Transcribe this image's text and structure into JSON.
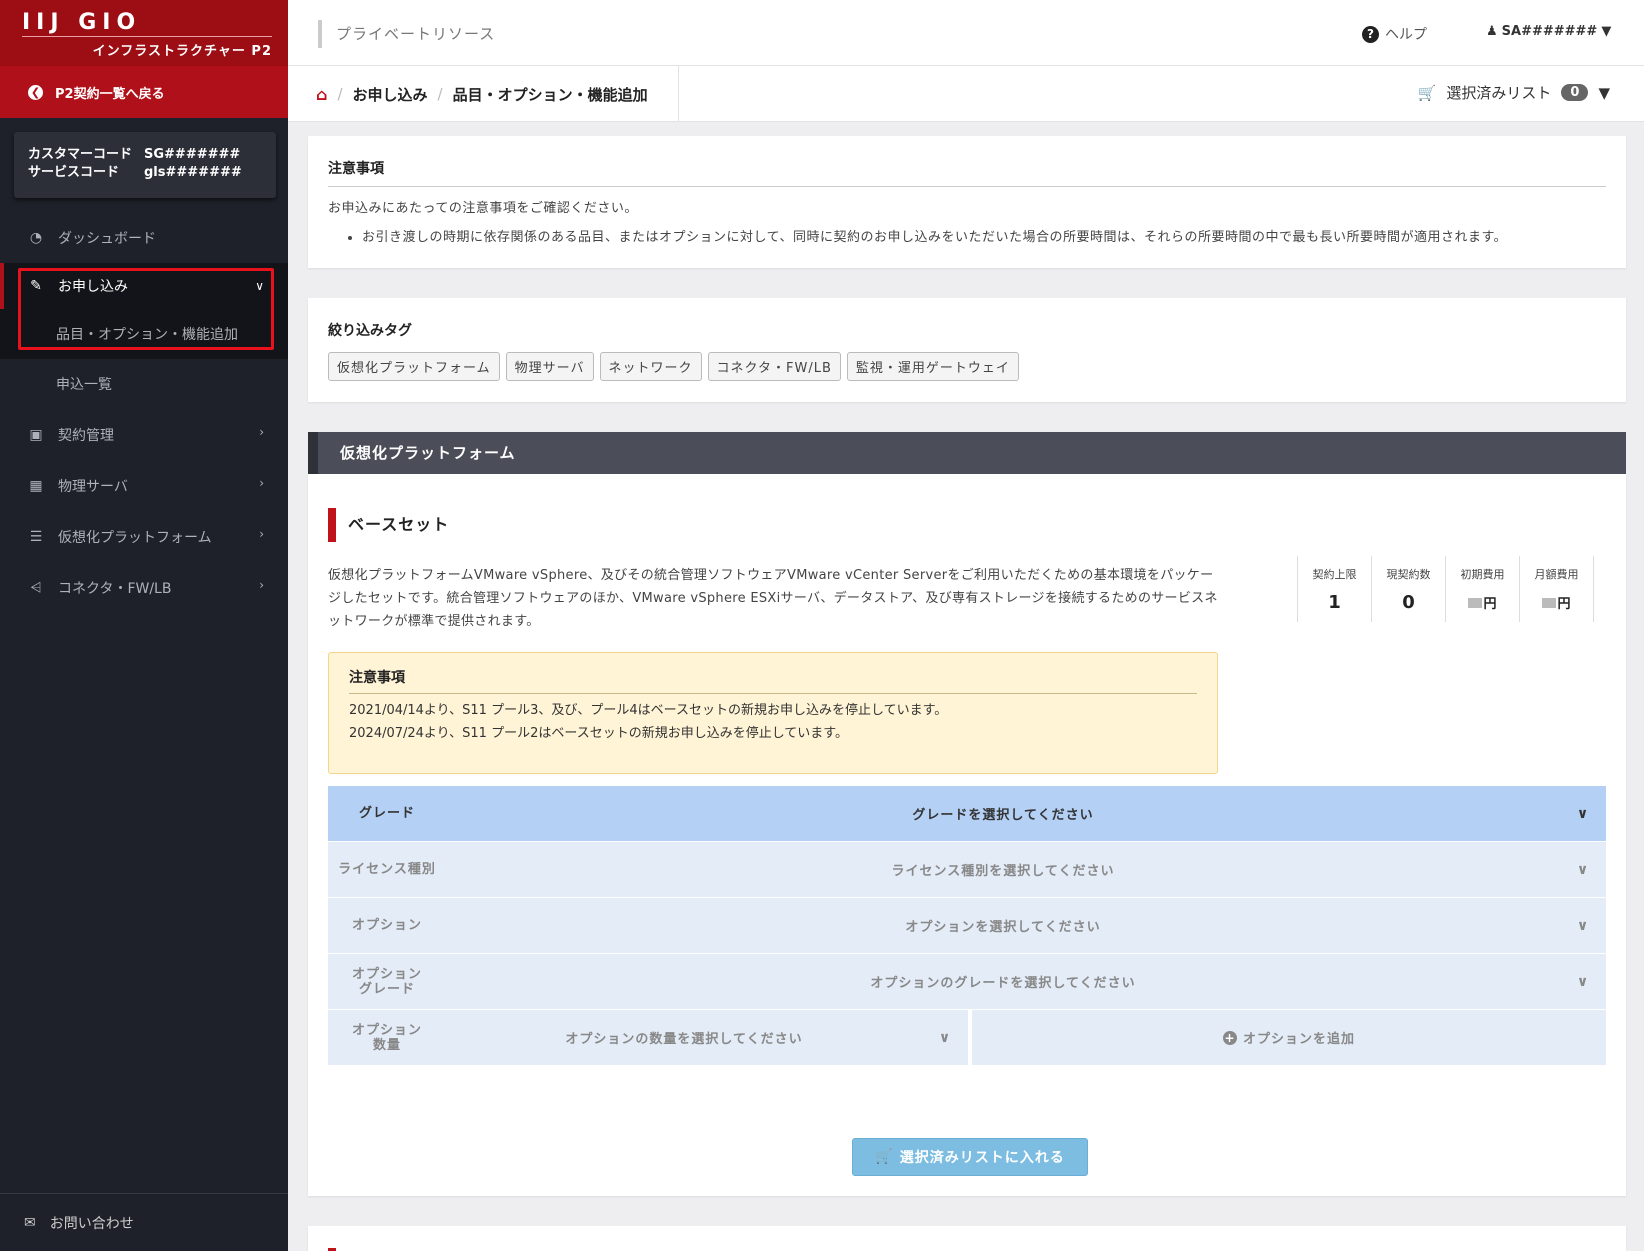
{
  "brand": {
    "logo": "IIJ GIO",
    "subtitle": "インフラストラクチャー P2",
    "back_label": "P2契約一覧へ戻る"
  },
  "codes": [
    {
      "key": "カスタマーコード",
      "value": "SG#######"
    },
    {
      "key": "サービスコード",
      "value": "gls#######"
    }
  ],
  "nav": {
    "dashboard": "ダッシュボード",
    "apply": "お申し込み",
    "apply_sub1": "品目・オプション・機能追加",
    "apply_sub2": "申込一覧",
    "contract": "契約管理",
    "physical": "物理サーバ",
    "virtual": "仮想化プラットフォーム",
    "connector": "コネクタ・FW/LB"
  },
  "contact": "お問い合わせ",
  "header": {
    "title": "プライベートリソース",
    "help": "ヘルプ",
    "user": "SA#######"
  },
  "breadcrumb": {
    "item1": "お申し込み",
    "item2": "品目・オプション・機能追加"
  },
  "cart": {
    "label": "選択済みリスト",
    "count": "0"
  },
  "notice": {
    "title": "注意事項",
    "intro": "お申込みにあたっての注意事項をご確認ください。",
    "item": "お引き渡しの時期に依存関係のある品目、またはオプションに対して、同時に契約のお申し込みをいただいた場合の所要時間は、それらの所要時間の中で最も長い所要時間が適用されます。"
  },
  "filter": {
    "title": "絞り込みタグ",
    "tags": [
      "仮想化プラットフォーム",
      "物理サーバ",
      "ネットワーク",
      "コネクタ・FW/LB",
      "監視・運用ゲートウェイ"
    ]
  },
  "section_title": "仮想化プラットフォーム",
  "baseset": {
    "title": "ベースセット",
    "desc": "仮想化プラットフォームVMware vSphere、及びその統合管理ソフトウェアVMware vCenter Serverをご利用いただくための基本環境をパッケージしたセットです。統合管理ソフトウェアのほか、VMware vSphere ESXiサーバ、データストア、及び専有ストレージを接続するためのサービスネットワークが標準で提供されます。",
    "stats": [
      {
        "label": "契約上限",
        "value": "1"
      },
      {
        "label": "現契約数",
        "value": "0"
      },
      {
        "label": "初期費用",
        "value": "円"
      },
      {
        "label": "月額費用",
        "value": "円"
      }
    ],
    "warning": {
      "title": "注意事項",
      "line1": "2021/04/14より、S11 プール3、及び、プール4はベースセットの新規お申し込みを停止しています。",
      "line2": "2024/07/24より、S11 プール2はベースセットの新規お申し込みを停止しています。"
    },
    "selectors": {
      "grade_label": "グレード",
      "grade_value": "グレードを選択してください",
      "license_label": "ライセンス種別",
      "license_value": "ライセンス種別を選択してください",
      "option_label": "オプション",
      "option_value": "オプションを選択してください",
      "option_grade_label1": "オプション",
      "option_grade_label2": "グレード",
      "option_grade_value": "オプションのグレードを選択してください",
      "option_qty_label1": "オプション",
      "option_qty_label2": "数量",
      "option_qty_value": "オプションの数量を選択してください",
      "add_option": "オプションを追加"
    },
    "add_button": "選択済みリストに入れる"
  }
}
